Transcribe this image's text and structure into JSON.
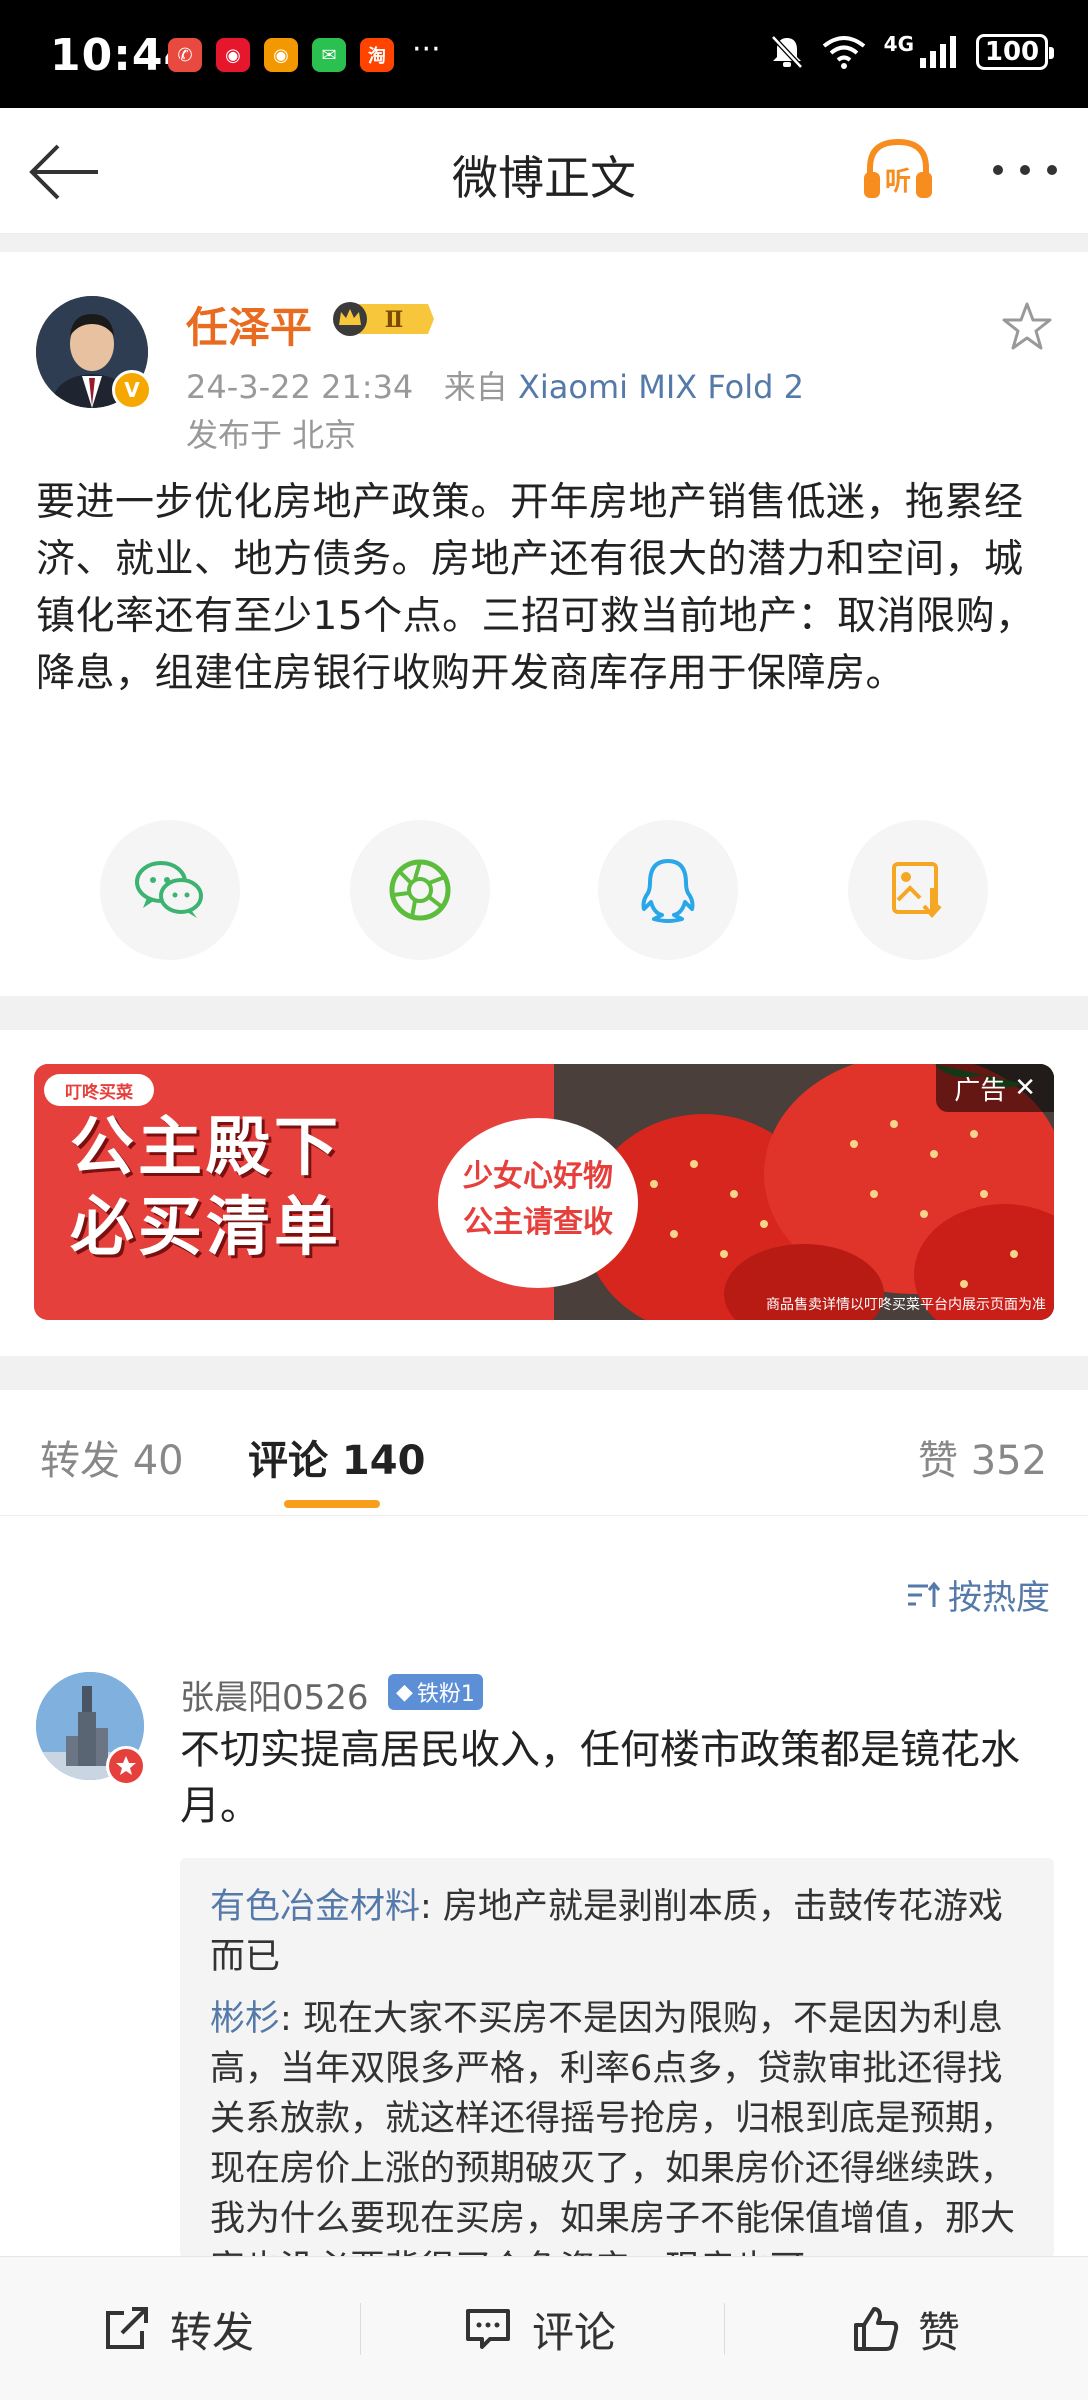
{
  "status_bar": {
    "time": "10:44",
    "app_icons": [
      {
        "name": "missed-call-icon",
        "glyph": "✆",
        "color": "#e84a3f"
      },
      {
        "name": "weibo-icon",
        "glyph": "◉",
        "color": "#e6162d"
      },
      {
        "name": "weibo-alt-icon",
        "glyph": "◉",
        "color": "#f39800"
      },
      {
        "name": "wechat-icon",
        "glyph": "✉",
        "color": "#2ac150"
      },
      {
        "name": "taobao-icon",
        "glyph": "淘",
        "color": "#ff4400"
      }
    ],
    "more": "···",
    "network": "4G",
    "battery": "100"
  },
  "nav": {
    "title": "微博正文",
    "listen_label": "听"
  },
  "post": {
    "author": "任泽平",
    "badge_level": "Ⅱ",
    "verified_mark": "V",
    "time": "24-3-22 21:34",
    "source_prefix": "来自",
    "device": "Xiaomi MIX Fold 2",
    "location": "发布于 北京",
    "text": "要进一步优化房地产政策。开年房地产销售低迷，拖累经济、就业、地方债务。房地产还有很大的潜力和空间，城镇化率还有至少15个点。三招可救当前地产：取消限购，降息，组建住房银行收购开发商库存用于保障房。"
  },
  "share_targets": [
    {
      "name": "wechat-share-icon",
      "color": "#3cb371"
    },
    {
      "name": "moments-share-icon",
      "color": "#5cbd3c"
    },
    {
      "name": "qq-share-icon",
      "color": "#2aa7e8"
    },
    {
      "name": "save-image-icon",
      "color": "#f5a623"
    }
  ],
  "ad": {
    "brand": "叮咚买菜",
    "headline_line1": "公主殿下",
    "headline_line2": "必买清单",
    "circle_line1": "少女心好物",
    "circle_line2": "公主请查收",
    "tag": "广告",
    "fine_print": "商品售卖详情以叮咚买菜平台内展示页面为准"
  },
  "tabs": {
    "repost": "转发 40",
    "comments": "评论 140",
    "likes": "赞 352"
  },
  "sort_label": "按热度",
  "comment": {
    "user": "张晨阳0526",
    "fan_badge": "铁粉1",
    "text": "不切实提高居民收入，任何楼市政策都是镜花水月。",
    "replies": [
      {
        "name": "有色冶金材料",
        "text": ": 房地产就是剥削本质，击鼓传花游戏而已"
      },
      {
        "name": "彬杉",
        "text": ": 现在大家不买房不是因为限购，不是因为利息高，当年双限多严格，利率6点多，贷款审批还得找关系放款，就这样还得摇号抢房，归根到底是预期，现在房价上涨的预期破灭了，如果房价还得继续跌，我为什么要现在买房，如果房子不能保值增值，那大家也没必要背很买个负资产，现房也可"
      }
    ]
  },
  "bottom_bar": {
    "repost": "转发",
    "comment": "评论",
    "like": "赞"
  }
}
